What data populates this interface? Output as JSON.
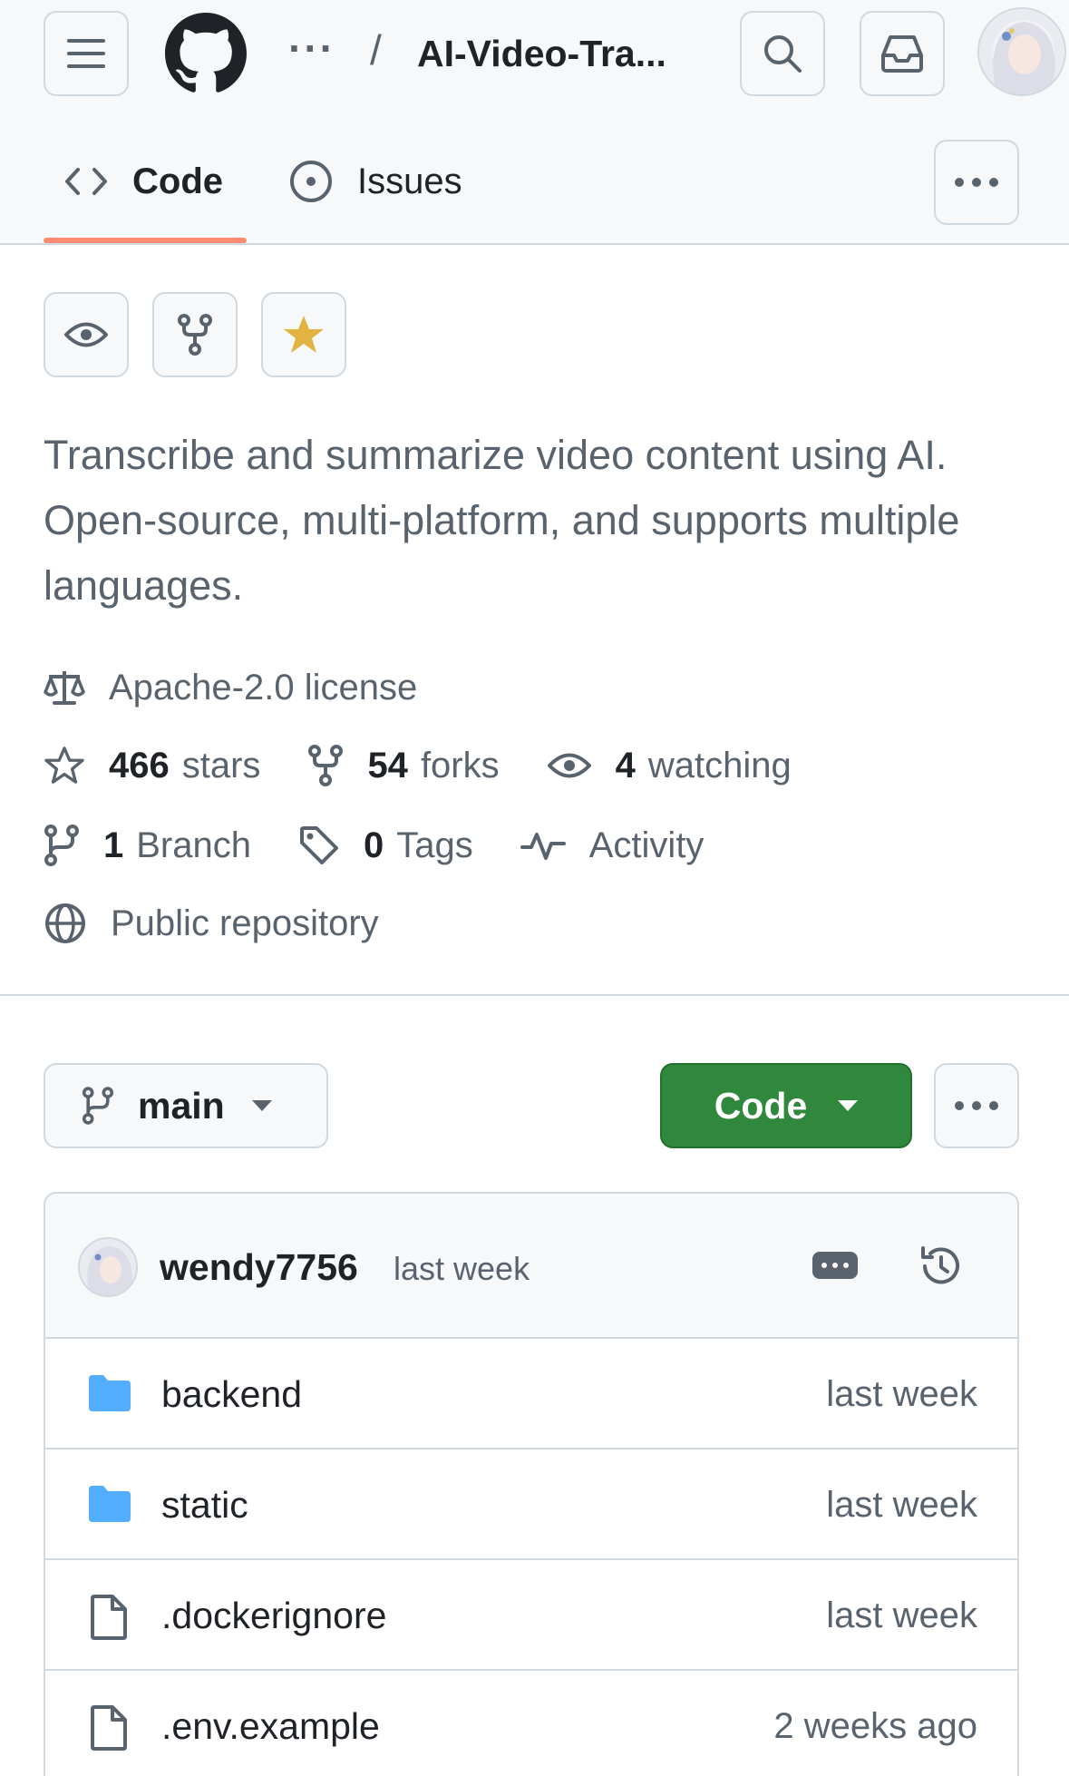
{
  "header": {
    "breadcrumb_ellipsis": "···",
    "separator": "/",
    "repo_name": "AI-Video-Tra...",
    "icons": [
      "menu-icon",
      "github-logo-icon",
      "search-icon",
      "inbox-icon"
    ],
    "user_avatar": "avatar"
  },
  "tabs": [
    {
      "label": "Code",
      "icon": "code-icon",
      "selected": true
    },
    {
      "label": "Issues",
      "icon": "issue-opened-icon",
      "selected": false
    }
  ],
  "tab_underline_color": "#fd8c73",
  "actions": {
    "icons": [
      "eye-icon",
      "repo-forked-icon",
      "star-fill-icon"
    ],
    "star_color": "#e3b341"
  },
  "description": "Transcribe and summarize video content using AI. Open-source, multi-platform, and supports multiple languages.",
  "meta": {
    "license": "Apache-2.0 license",
    "stars_count": "466",
    "stars_label": "stars",
    "forks_count": "54",
    "forks_label": "forks",
    "watching_count": "4",
    "watching_label": "watching",
    "branch_count": "1",
    "branch_label": "Branch",
    "tags_count": "0",
    "tags_label": "Tags",
    "activity_label": "Activity",
    "visibility": "Public repository"
  },
  "toolbar": {
    "branch_name": "main",
    "code_button_label": "Code",
    "code_button_color": "#2f883b"
  },
  "latest_commit": {
    "user": "wendy7756",
    "time": "last week"
  },
  "files": [
    {
      "name": "backend",
      "type": "folder",
      "time": "last week"
    },
    {
      "name": "static",
      "type": "folder",
      "time": "last week"
    },
    {
      "name": ".dockerignore",
      "type": "file",
      "time": "last week"
    },
    {
      "name": ".env.example",
      "type": "file",
      "time": "2 weeks ago"
    }
  ]
}
